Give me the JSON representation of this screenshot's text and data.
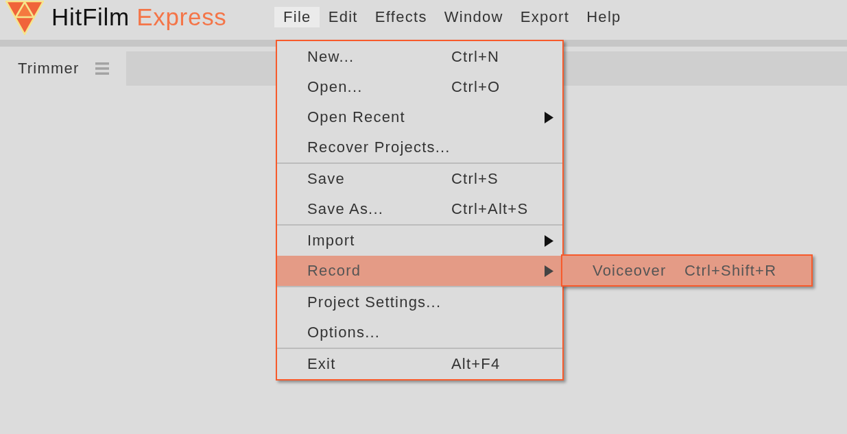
{
  "app": {
    "name": "HitFilm",
    "edition": "Express"
  },
  "menu_bar": {
    "items": [
      {
        "label": "File",
        "selected": true,
        "dropdown": {
          "sections": [
            {
              "items": [
                {
                  "label": "New...",
                  "shortcut": "Ctrl+N",
                  "kind": "command",
                  "selected": false
                },
                {
                  "label": "Open...",
                  "shortcut": "Ctrl+O",
                  "kind": "command",
                  "selected": false
                },
                {
                  "label": "Open Recent",
                  "kind": "submenu",
                  "selected": false
                },
                {
                  "label": "Recover Projects...",
                  "kind": "command",
                  "selected": false
                }
              ]
            },
            {
              "items": [
                {
                  "label": "Save",
                  "shortcut": "Ctrl+S",
                  "kind": "command",
                  "selected": false
                },
                {
                  "label": "Save As...",
                  "shortcut": "Ctrl+Alt+S",
                  "kind": "command",
                  "selected": false
                }
              ]
            },
            {
              "items": [
                {
                  "label": "Import",
                  "kind": "submenu",
                  "selected": false
                },
                {
                  "label": "Record",
                  "kind": "submenu",
                  "selected": true,
                  "submenu": {
                    "items": [
                      {
                        "label": "Voiceover",
                        "shortcut": "Ctrl+Shift+R",
                        "selected": true
                      }
                    ]
                  }
                }
              ]
            },
            {
              "items": [
                {
                  "label": "Project Settings...",
                  "kind": "command",
                  "selected": false
                },
                {
                  "label": "Options...",
                  "kind": "command",
                  "selected": false
                }
              ]
            },
            {
              "items": [
                {
                  "label": "Exit",
                  "shortcut": "Alt+F4",
                  "kind": "command",
                  "selected": false
                }
              ]
            }
          ]
        }
      },
      {
        "label": "Edit",
        "selected": false
      },
      {
        "label": "Effects",
        "selected": false
      },
      {
        "label": "Window",
        "selected": false
      },
      {
        "label": "Export",
        "selected": false
      },
      {
        "label": "Help",
        "selected": false
      }
    ]
  },
  "tabs": [
    {
      "label": "Trimmer",
      "selected": true
    }
  ]
}
